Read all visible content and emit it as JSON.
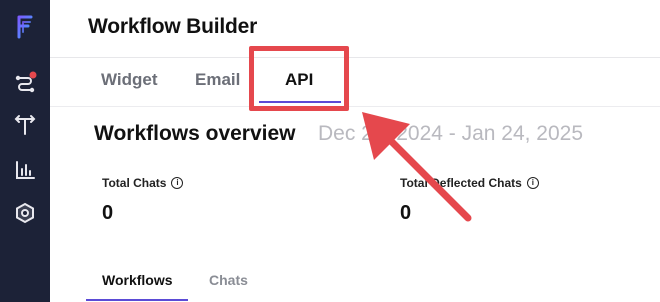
{
  "header": {
    "title": "Workflow Builder"
  },
  "sidebar": {
    "items": [
      {
        "icon": "logo-icon"
      },
      {
        "icon": "flow-icon",
        "has_notification": true
      },
      {
        "icon": "split-icon"
      },
      {
        "icon": "bar-chart-icon"
      },
      {
        "icon": "settings-hex-icon"
      }
    ]
  },
  "tabs": [
    {
      "label": "Widget",
      "active": false
    },
    {
      "label": "Email",
      "active": false
    },
    {
      "label": "API",
      "active": true
    }
  ],
  "overview": {
    "title": "Workflows overview",
    "date_range": "Dec 24, 2024 - Jan 24, 2025"
  },
  "metrics": [
    {
      "label": "Total Chats",
      "value": "0"
    },
    {
      "label": "Total Deflected Chats",
      "value": "0"
    }
  ],
  "bottom_tabs": [
    {
      "label": "Workflows",
      "active": true
    },
    {
      "label": "Chats",
      "active": false
    }
  ],
  "colors": {
    "sidebar_bg": "#1c2237",
    "accent": "#5b4bd6",
    "annotation_red": "#e5484d"
  }
}
